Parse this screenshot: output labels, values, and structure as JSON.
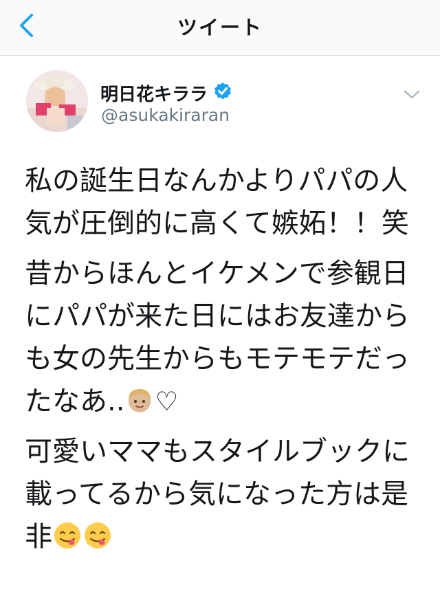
{
  "nav": {
    "title": "ツイート",
    "back_icon": "chevron-left-icon"
  },
  "author": {
    "display_name": "明日花キララ",
    "username": "@asukakiraran",
    "verified_icon": "verified-badge-icon"
  },
  "tweet": {
    "paragraphs": [
      "私の誕生日なんかよりパパの人気が圧倒的に高くて嫉妬！！笑",
      "昔からほんとイケメンで参観日にパパが来た日にはお友達からも女の先生からもモテモテだったなあ..",
      "可愛いママもスタイルブックに載ってるから気になった方は是非"
    ],
    "p2_heart": "♡",
    "emojis": [
      "man-blond-emoji",
      "face-savoring-food-emoji",
      "face-savoring-food-emoji"
    ]
  },
  "colors": {
    "accent": "#1da1f2",
    "text": "#14171a",
    "secondary": "#657786",
    "divider": "#d6d9dc"
  }
}
